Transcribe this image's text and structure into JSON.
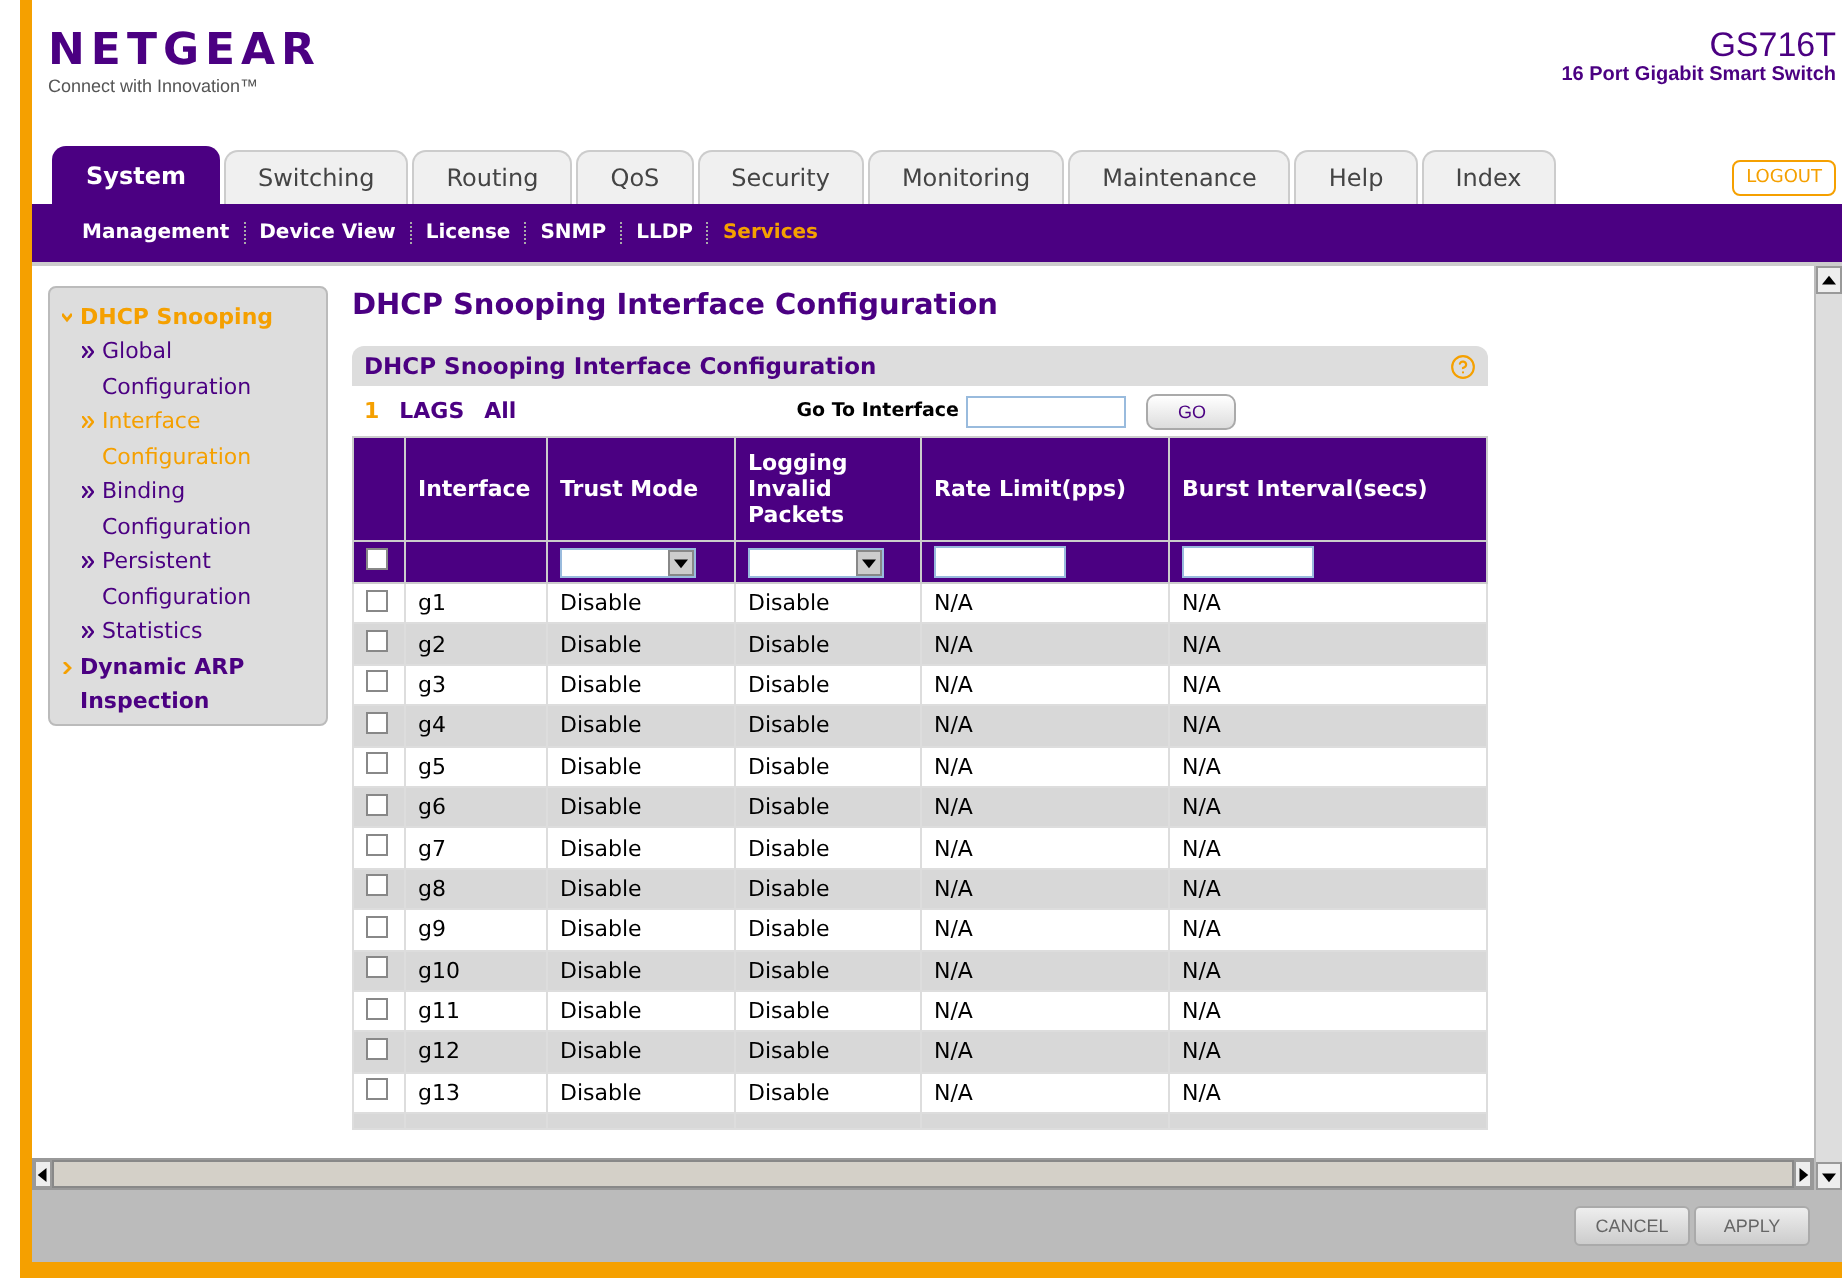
{
  "brand": {
    "logo": "NETGEAR",
    "tagline": "Connect with Innovation™",
    "model": "GS716T",
    "model_desc": "16 Port Gigabit Smart Switch"
  },
  "tabs": [
    {
      "label": "System",
      "selected": true
    },
    {
      "label": "Switching",
      "selected": false
    },
    {
      "label": "Routing",
      "selected": false
    },
    {
      "label": "QoS",
      "selected": false
    },
    {
      "label": "Security",
      "selected": false
    },
    {
      "label": "Monitoring",
      "selected": false
    },
    {
      "label": "Maintenance",
      "selected": false
    },
    {
      "label": "Help",
      "selected": false
    },
    {
      "label": "Index",
      "selected": false
    }
  ],
  "logout": "LOGOUT",
  "subnav": [
    {
      "label": "Management",
      "selected": false
    },
    {
      "label": "Device View",
      "selected": false
    },
    {
      "label": "License",
      "selected": false
    },
    {
      "label": "SNMP",
      "selected": false
    },
    {
      "label": "LLDP",
      "selected": false
    },
    {
      "label": "Services",
      "selected": true
    }
  ],
  "sidebar": [
    {
      "label": "DHCP Snooping",
      "expanded": true,
      "children": [
        {
          "label": "Global Configuration",
          "selected": false
        },
        {
          "label": "Interface Configuration",
          "selected": true
        },
        {
          "label": "Binding Configuration",
          "selected": false
        },
        {
          "label": "Persistent Configuration",
          "selected": false
        },
        {
          "label": "Statistics",
          "selected": false
        }
      ]
    },
    {
      "label": "Dynamic ARP Inspection",
      "expanded": false
    }
  ],
  "page_title": "DHCP Snooping Interface Configuration",
  "panel": {
    "title": "DHCP Snooping Interface Configuration",
    "filters": [
      {
        "label": "1",
        "selected": true
      },
      {
        "label": "LAGS",
        "selected": false
      },
      {
        "label": "All",
        "selected": false
      }
    ],
    "goto_label": "Go To Interface",
    "go": "GO",
    "columns": [
      "Interface",
      "Trust Mode",
      "Logging Invalid Packets",
      "Rate Limit(pps)",
      "Burst Interval(secs)"
    ],
    "select_all_checked": false,
    "rows": [
      {
        "checked": false,
        "cells": [
          "g1",
          "Disable",
          "Disable",
          "N/A",
          "N/A"
        ]
      },
      {
        "checked": false,
        "cells": [
          "g2",
          "Disable",
          "Disable",
          "N/A",
          "N/A"
        ]
      },
      {
        "checked": false,
        "cells": [
          "g3",
          "Disable",
          "Disable",
          "N/A",
          "N/A"
        ]
      },
      {
        "checked": false,
        "cells": [
          "g4",
          "Disable",
          "Disable",
          "N/A",
          "N/A"
        ]
      },
      {
        "checked": false,
        "cells": [
          "g5",
          "Disable",
          "Disable",
          "N/A",
          "N/A"
        ]
      },
      {
        "checked": false,
        "cells": [
          "g6",
          "Disable",
          "Disable",
          "N/A",
          "N/A"
        ]
      },
      {
        "checked": false,
        "cells": [
          "g7",
          "Disable",
          "Disable",
          "N/A",
          "N/A"
        ]
      },
      {
        "checked": false,
        "cells": [
          "g8",
          "Disable",
          "Disable",
          "N/A",
          "N/A"
        ]
      },
      {
        "checked": false,
        "cells": [
          "g9",
          "Disable",
          "Disable",
          "N/A",
          "N/A"
        ]
      },
      {
        "checked": false,
        "cells": [
          "g10",
          "Disable",
          "Disable",
          "N/A",
          "N/A"
        ]
      },
      {
        "checked": false,
        "cells": [
          "g11",
          "Disable",
          "Disable",
          "N/A",
          "N/A"
        ]
      },
      {
        "checked": false,
        "cells": [
          "g12",
          "Disable",
          "Disable",
          "N/A",
          "N/A"
        ]
      },
      {
        "checked": false,
        "cells": [
          "g13",
          "Disable",
          "Disable",
          "N/A",
          "N/A"
        ]
      }
    ]
  },
  "buttons": [
    "CANCEL",
    "APPLY"
  ]
}
